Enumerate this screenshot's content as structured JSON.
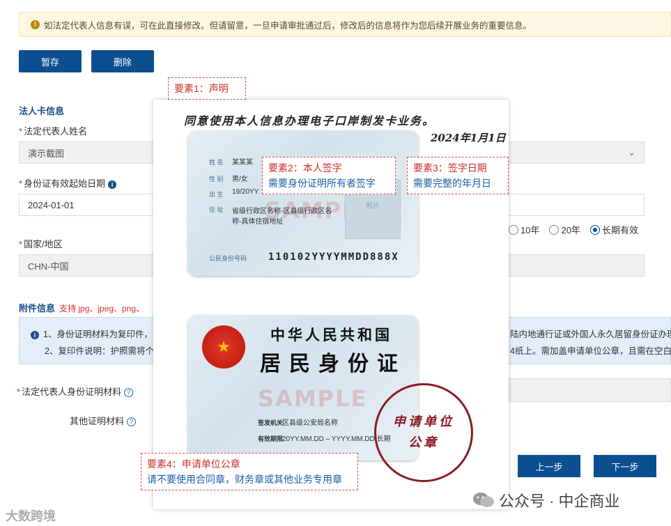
{
  "notice": {
    "icon": "warning-icon",
    "text": "如法定代表人信息有误，可在此直接修改。但请留意，一旦申请审批通过后，修改后的信息将作为您后续开展业务的重要信息。"
  },
  "toolbar": {
    "save_label": "暂存",
    "delete_label": "删除"
  },
  "legal_card": {
    "section_title": "法人卡信息",
    "name_label": "法定代表人姓名",
    "name_value": "演示截图",
    "id_start_label": "身份证有效起始日期",
    "id_start_value": "2024-01-01",
    "validity_options": [
      {
        "label": "10年",
        "selected": false
      },
      {
        "label": "20年",
        "selected": false
      },
      {
        "label": "长期有效",
        "selected": true
      }
    ],
    "country_label": "国家/地区",
    "country_value": "CHN-中国"
  },
  "attachments": {
    "section_title": "附件信息",
    "support_text": "支持 jpg、jpeg、png、",
    "info_line1": "1、身份证明材料为复印件，",
    "info_line1_right": "陆内地通行证或外国人永久居留身份证办理",
    "info_line2": "2、复印件说明：护照需将个",
    "info_line2_right": "4纸上。需加盖申请单位公章，且需在空白",
    "legal_id_label": "法定代表人身份证明材料",
    "other_label": "其他证明材料"
  },
  "sample": {
    "declaration": "同意使用本人信息办理电子口岸制发卡业务。",
    "signature_label": "签字",
    "signature_date": "2024年1月1日",
    "front": {
      "name_key": "姓 名",
      "name_val": "某某某",
      "sex_key": "性 别",
      "sex_val": "男/女",
      "birth_key": "出 生",
      "birth_val": "19/20YY",
      "addr_key": "住 址",
      "addr_val1": "省级行政区名称-区县级行政区名",
      "addr_val2": "称-具体住宿地址",
      "photo_label": "照片",
      "id_key": "公民身份号码",
      "id_val": "110102YYYYMMDD888X",
      "watermark": "SAMPLE"
    },
    "back": {
      "title1": "中华人民共和国",
      "title2": "居民身份证",
      "issuer_key": "签发机关",
      "issuer_val": "区县级公安局名称",
      "period_key": "有效期限",
      "period_val": "20YY.MM.DD – YYYY.MM.DD/长期",
      "watermark": "SAMPLE"
    },
    "seal_line1": "申请单位",
    "seal_line2": "公章",
    "callouts": [
      {
        "head": "要素1：声明"
      },
      {
        "head": "要素2：本人签字",
        "body": "需要身份证明所有者签字"
      },
      {
        "head": "要素3：签字日期",
        "body": "需要完整的年月日"
      },
      {
        "head": "要素4：申请单位公章",
        "body": "请不要使用合同章，财务章或其他业务专用章"
      }
    ]
  },
  "nav": {
    "prev_label": "上一步",
    "next_label": "下一步"
  },
  "watermarks": {
    "wechat": "公众号 · 中企商业",
    "left": "大数跨境"
  },
  "colors": {
    "primary": "#0b4f91",
    "required": "#d9302c",
    "callout_head": "#c9302c",
    "callout_body": "#1a5fa8",
    "seal": "#8c1a24"
  }
}
